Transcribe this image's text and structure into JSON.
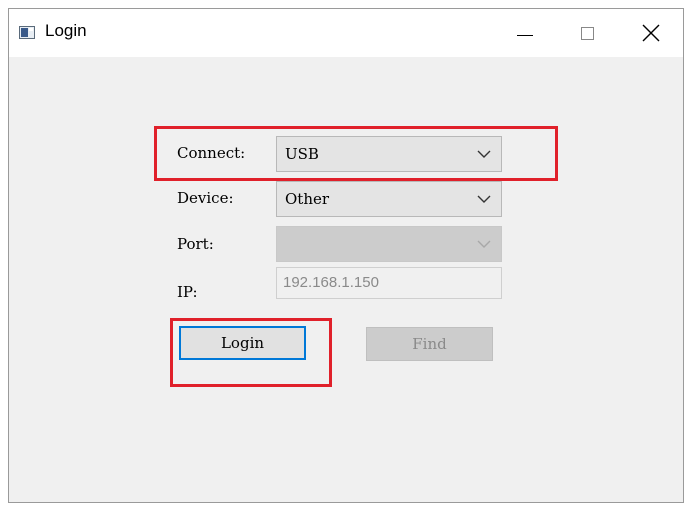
{
  "window": {
    "title": "Login"
  },
  "form": {
    "connect": {
      "label": "Connect:",
      "value": "USB"
    },
    "device": {
      "label": "Device:",
      "value": "Other"
    },
    "port": {
      "label": "Port:",
      "value": ""
    },
    "ip": {
      "label": "IP:",
      "value": "192.168.1.150"
    }
  },
  "buttons": {
    "login": "Login",
    "find": "Find"
  },
  "annotations": {
    "highlight_color": "#e0202a"
  },
  "colors": {
    "focus_border": "#0078d7",
    "window_bg": "#f0f0f0"
  }
}
